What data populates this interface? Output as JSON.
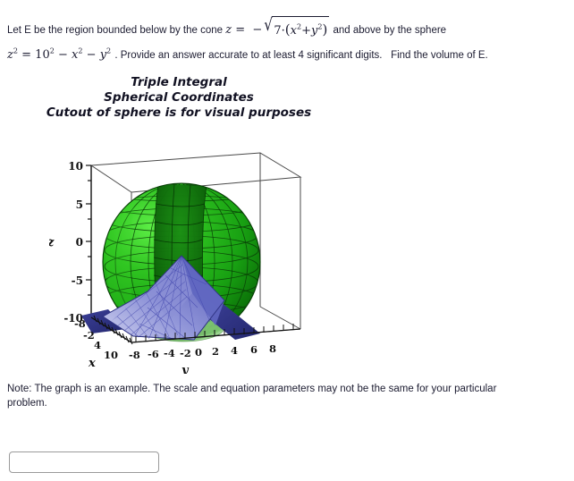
{
  "problem": {
    "line1_part1": "Let E be the region bounded below by the cone",
    "cone_z": "z",
    "cone_equals": "=",
    "cone_minus": "−",
    "cone_radicand_coef": "7",
    "cone_radicand_dot": "·",
    "cone_radicand_x": "x",
    "cone_radicand_plus": "+",
    "cone_radicand_y": "y",
    "exp2": "2",
    "line1_part2": "and above by the sphere",
    "sphere_z": "z",
    "sphere_equals": "=",
    "sphere_ten": "10",
    "sphere_minus1": "−",
    "sphere_x": "x",
    "sphere_minus2": "−",
    "sphere_y": "y",
    "line2_part2": ". Provide an answer accurate to at least 4 significant digits.",
    "line2_part3": "Find the volume of E."
  },
  "figure_title": {
    "line1": "Triple Integral",
    "line2": "Spherical Coordinates",
    "line3": "Cutout of sphere is for visual purposes"
  },
  "note": {
    "text": "Note:  The graph is an example.  The scale and equation parameters may not be the same for your particular problem."
  },
  "answer": {
    "value": "",
    "placeholder": ""
  },
  "chart_data": {
    "type": "surface3d",
    "title": "Triple Integral / Spherical Coordinates / Cutout of sphere is for visual purposes",
    "xlabel": "x",
    "ylabel": "y",
    "zlabel": "z",
    "xlim": [
      -10,
      10
    ],
    "ylim": [
      -10,
      10
    ],
    "zlim": [
      -10,
      10
    ],
    "grid": true,
    "legend": "none",
    "axes": {
      "z_ticks": [
        "10",
        "5",
        "0",
        "-5",
        "-10"
      ],
      "z_tick_values": [
        10,
        5,
        0,
        -5,
        -10
      ],
      "x_ticks": [
        "-8",
        "-2",
        "4",
        "10"
      ],
      "x_tick_values": [
        -8,
        -2,
        4,
        10
      ],
      "y_ticks": [
        "-8",
        "-6",
        "-4",
        "-2",
        "0",
        "2",
        "4",
        "6",
        "8"
      ],
      "y_tick_values": [
        -8,
        -6,
        -4,
        -2,
        0,
        2,
        4,
        6,
        8
      ]
    },
    "surfaces": [
      {
        "name": "sphere",
        "equation": "z^2 = 10^2 - x^2 - y^2",
        "radius": 10,
        "color": "#1aa316",
        "highlight_color": "#46e03a",
        "shadow_color": "#0d6b0a",
        "mesh_color": "#0a3d08",
        "cutout": true,
        "cutout_note": "wedge removed for visual purposes"
      },
      {
        "name": "cone",
        "equation": "z = -sqrt(7*(x^2 + y^2))",
        "coefficient": 7,
        "color": "#6f74c8",
        "highlight_color": "#b9bbe6",
        "shadow_color": "#2c2f7a",
        "mesh_color": "#3b3f96"
      }
    ],
    "box_color": "#4a4a4a"
  }
}
